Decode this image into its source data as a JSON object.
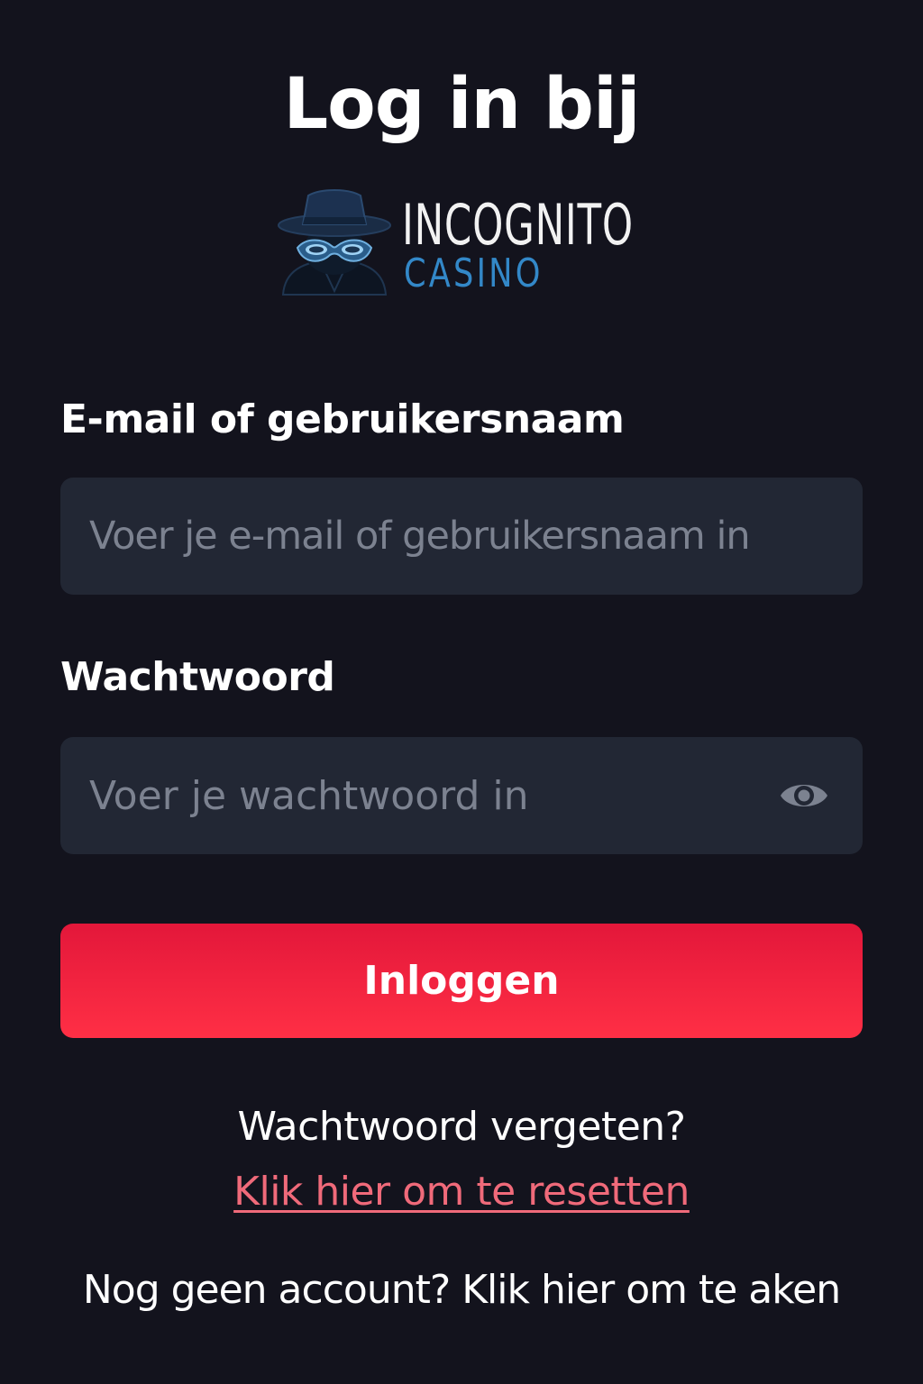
{
  "header": {
    "title": "Log in bij"
  },
  "logo": {
    "name": "INCOGNITO",
    "sub": "CASINO",
    "icon": "spy-hat-mask-icon",
    "name_color": "#f2f2f2",
    "sub_color": "#3388c8"
  },
  "form": {
    "email": {
      "label": "E-mail of gebruikersnaam",
      "placeholder": "Voer je e-mail of gebruikersnaam in",
      "value": ""
    },
    "password": {
      "label": "Wachtwoord",
      "placeholder": "Voer je wachtwoord in",
      "value": "",
      "toggle_icon": "eye-icon"
    },
    "submit_label": "Inloggen"
  },
  "footer": {
    "forgot_text": "Wachtwoord vergeten?",
    "reset_link": "Klik hier om te resetten",
    "signup_prompt": "Nog geen account?",
    "signup_link": "Klik hier om te aken"
  },
  "colors": {
    "background": "#13131d",
    "input_bg": "#222734",
    "accent": "#ff2f45",
    "link": "#f06a7a",
    "placeholder": "#7c8290"
  }
}
